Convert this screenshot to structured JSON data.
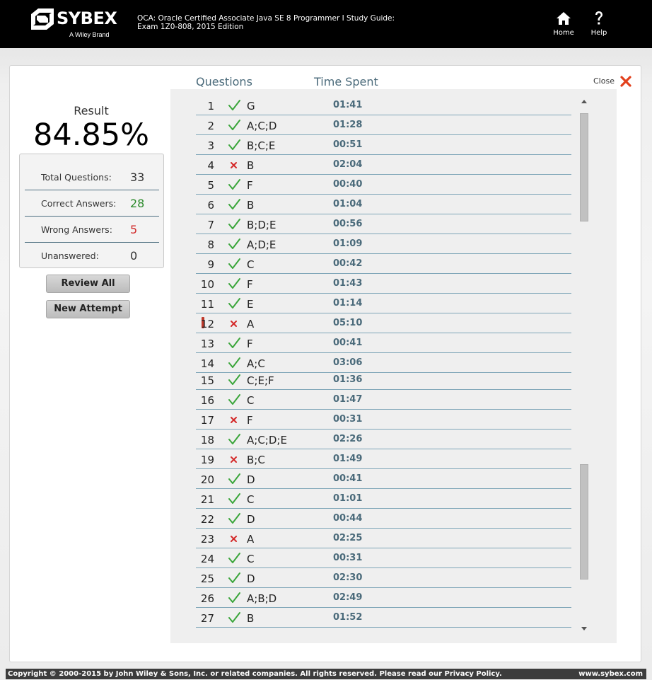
{
  "header": {
    "logo_text": "SYBEX",
    "logo_sub": "A Wiley Brand",
    "book_title_line1": "OCA: Oracle Certified Associate Java SE 8 Programmer I Study Guide:",
    "book_title_line2": "Exam 1Z0-808, 2015 Edition",
    "home_label": "Home",
    "help_label": "Help",
    "home_icon": "home-icon",
    "help_icon": "question-icon"
  },
  "columns": {
    "questions": "Questions",
    "time_spent": "Time Spent"
  },
  "close": {
    "label": "Close",
    "icon": "close-icon"
  },
  "summary": {
    "result_label": "Result",
    "result_value": "84.85%",
    "total_label": "Total Questions:",
    "total_value": "33",
    "correct_label": "Correct Answers:",
    "correct_value": "28",
    "wrong_label": "Wrong Answers:",
    "wrong_value": "5",
    "unanswered_label": "Unanswered:",
    "unanswered_value": "0"
  },
  "buttons": {
    "review_all": "Review All",
    "new_attempt": "New Attempt"
  },
  "colors": {
    "correct": "#3aa53a",
    "wrong": "#d42a2a",
    "accent": "#4a6a7a",
    "close_x": "#e2401c",
    "flag": "#c0392b"
  },
  "questions": [
    {
      "num": "1",
      "status": "correct",
      "answer": "G",
      "time": "01:41"
    },
    {
      "num": "2",
      "status": "correct",
      "answer": "A;C;D",
      "time": "01:28"
    },
    {
      "num": "3",
      "status": "correct",
      "answer": "B;C;E",
      "time": "00:51"
    },
    {
      "num": "4",
      "status": "wrong",
      "answer": "B",
      "time": "02:04"
    },
    {
      "num": "5",
      "status": "correct",
      "answer": "F",
      "time": "00:40"
    },
    {
      "num": "6",
      "status": "correct",
      "answer": "B",
      "time": "01:04"
    },
    {
      "num": "7",
      "status": "correct",
      "answer": "B;D;E",
      "time": "00:56"
    },
    {
      "num": "8",
      "status": "correct",
      "answer": "A;D;E",
      "time": "01:09"
    },
    {
      "num": "9",
      "status": "correct",
      "answer": "C",
      "time": "00:42"
    },
    {
      "num": "10",
      "status": "correct",
      "answer": "F",
      "time": "01:43"
    },
    {
      "num": "11",
      "status": "correct",
      "answer": "E",
      "time": "01:14"
    },
    {
      "num": "12",
      "status": "wrong",
      "answer": "A",
      "time": "05:10",
      "flagged": true
    },
    {
      "num": "13",
      "status": "correct",
      "answer": "F",
      "time": "00:41"
    },
    {
      "num": "14",
      "status": "correct",
      "answer": "A;C",
      "time": "03:06"
    },
    {
      "num": "15",
      "status": "correct",
      "answer": "C;E;F",
      "time": "01:36"
    },
    {
      "num": "16",
      "status": "correct",
      "answer": "C",
      "time": "01:47"
    },
    {
      "num": "17",
      "status": "wrong",
      "answer": "F",
      "time": "00:31"
    },
    {
      "num": "18",
      "status": "correct",
      "answer": "A;C;D;E",
      "time": "02:26"
    },
    {
      "num": "19",
      "status": "wrong",
      "answer": "B;C",
      "time": "01:49"
    },
    {
      "num": "20",
      "status": "correct",
      "answer": "D",
      "time": "00:41"
    },
    {
      "num": "21",
      "status": "correct",
      "answer": "C",
      "time": "01:01"
    },
    {
      "num": "22",
      "status": "correct",
      "answer": "D",
      "time": "00:44"
    },
    {
      "num": "23",
      "status": "wrong",
      "answer": "A",
      "time": "02:25"
    },
    {
      "num": "24",
      "status": "correct",
      "answer": "C",
      "time": "00:31"
    },
    {
      "num": "25",
      "status": "correct",
      "answer": "D",
      "time": "02:30"
    },
    {
      "num": "26",
      "status": "correct",
      "answer": "A;B;D",
      "time": "02:49"
    },
    {
      "num": "27",
      "status": "correct",
      "answer": "B",
      "time": "01:52"
    }
  ],
  "footer": {
    "copyright": "Copyright © 2000-2015 by John Wiley & Sons, Inc. or related companies. All rights reserved. Please read our Privacy Policy.",
    "site": "www.sybex.com"
  }
}
